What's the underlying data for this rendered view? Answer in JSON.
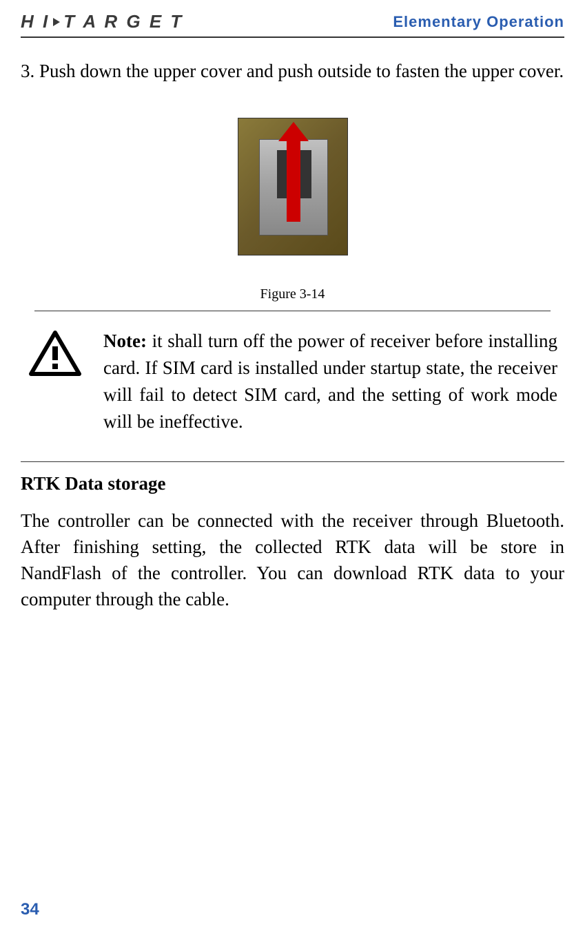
{
  "header": {
    "logo_text_1": "H I",
    "logo_text_2": "T A R G E T",
    "section_title": "Elementary Operation"
  },
  "content": {
    "step3_text": "3. Push down the upper cover and push outside to fasten the upper cover.",
    "figure_caption": "Figure 3-14",
    "note_label": "Note:",
    "note_text": " it shall turn off the power of receiver before installing card. If SIM card is installed under startup state, the receiver will fail to detect SIM card, and the setting of work mode will be ineffective.",
    "rtk_heading": "RTK Data storage",
    "rtk_body": "The controller can be connected with the receiver through Bluetooth. After finishing setting, the collected RTK data will be store in NandFlash of the controller. You can download RTK data to your computer through the cable."
  },
  "page_number": "34"
}
